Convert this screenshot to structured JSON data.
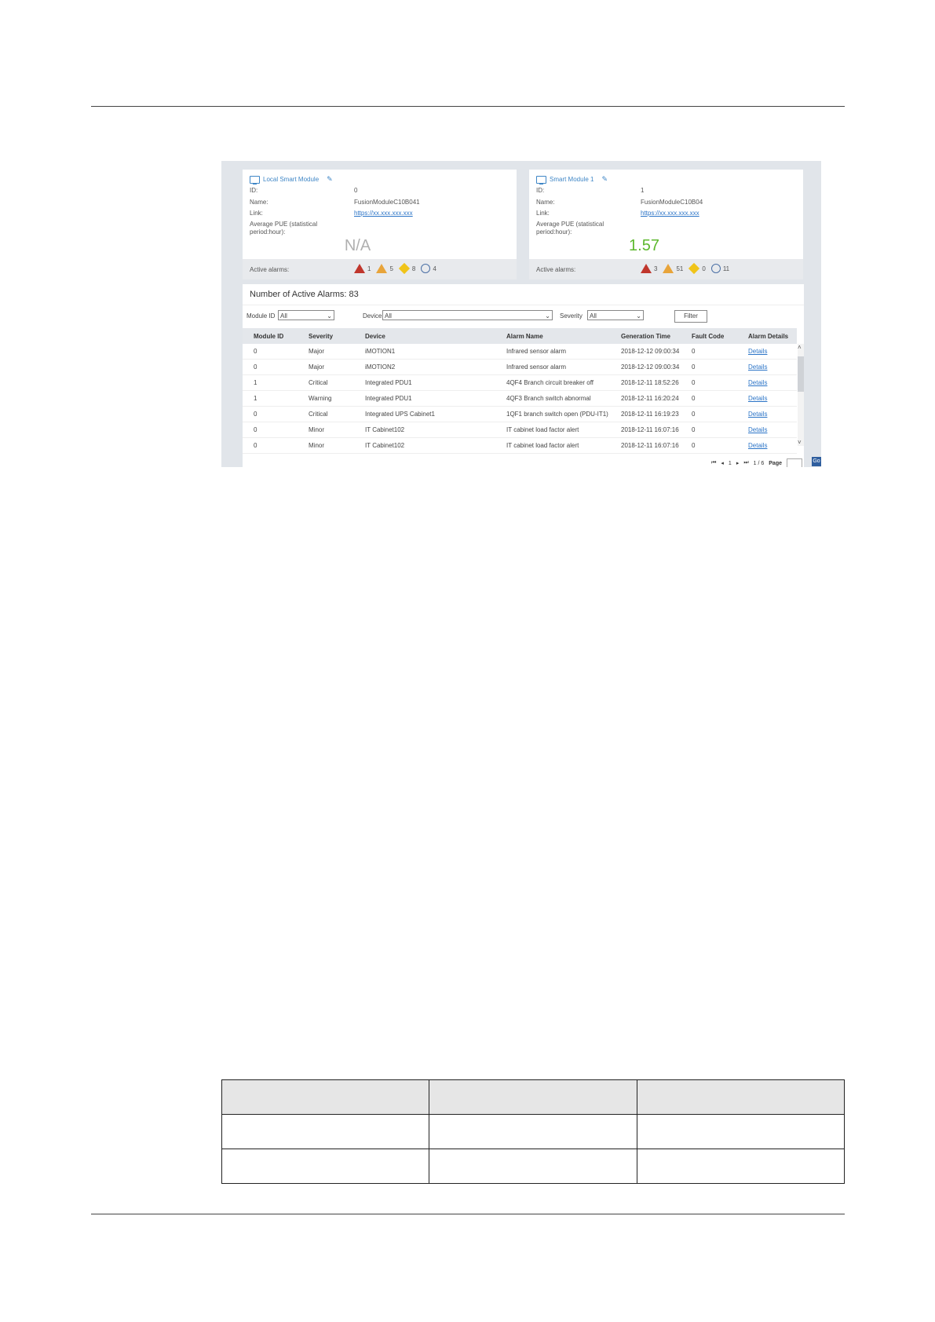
{
  "figure": {
    "modules": [
      {
        "title": "Local Smart Module",
        "fields": [
          {
            "label": "ID:",
            "value": "0"
          },
          {
            "label": "Name:",
            "value": "FusionModuleC10B041"
          },
          {
            "label": "Link:",
            "value": "https://xx.xxx.xxx.xxx"
          }
        ],
        "pue_label_1": "Average PUE (statistical",
        "pue_label_2": "period:hour):",
        "pue_value": "N/A",
        "alarms_label": "Active alarms:",
        "alarm_counts": {
          "critical": "1",
          "major": "5",
          "minor": "8",
          "warning": "4"
        }
      },
      {
        "title": "Smart Module 1",
        "fields": [
          {
            "label": "ID:",
            "value": "1"
          },
          {
            "label": "Name:",
            "value": "FusionModuleC10B04"
          },
          {
            "label": "Link:",
            "value": "https://xx.xxx.xxx.xxx"
          }
        ],
        "pue_label_1": "Average PUE (statistical",
        "pue_label_2": "period:hour):",
        "pue_value": "1.57",
        "alarms_label": "Active alarms:",
        "alarm_counts": {
          "critical": "3",
          "major": "51",
          "minor": "0",
          "warning": "11"
        }
      }
    ],
    "alarms_heading": "Number of Active Alarms: 83",
    "filters": {
      "module_id_label": "Module ID",
      "module_id_value": "All",
      "device_label": "Device",
      "device_value": "All",
      "severity_label": "Severity",
      "severity_value": "All",
      "filter_button": "Filter"
    },
    "table": {
      "headers": [
        "Module ID",
        "Severity",
        "Device",
        "Alarm Name",
        "Generation Time",
        "Fault Code",
        "Alarm Details"
      ],
      "rows": [
        [
          "0",
          "Major",
          "iMOTION1",
          "Infrared sensor alarm",
          "2018-12-12 09:00:34",
          "0",
          "Details"
        ],
        [
          "0",
          "Major",
          "iMOTION2",
          "Infrared sensor alarm",
          "2018-12-12 09:00:34",
          "0",
          "Details"
        ],
        [
          "1",
          "Critical",
          "Integrated PDU1",
          "4QF4 Branch circuit breaker off",
          "2018-12-11 18:52:26",
          "0",
          "Details"
        ],
        [
          "1",
          "Warning",
          "Integrated PDU1",
          "4QF3 Branch switch abnormal",
          "2018-12-11 16:20:24",
          "0",
          "Details"
        ],
        [
          "0",
          "Critical",
          "Integrated UPS Cabinet1",
          "1QF1 branch switch open (PDU-IT1)",
          "2018-12-11 16:19:23",
          "0",
          "Details"
        ],
        [
          "0",
          "Minor",
          "IT Cabinet102",
          "IT cabinet load factor alert",
          "2018-12-11 16:07:16",
          "0",
          "Details"
        ],
        [
          "0",
          "Minor",
          "IT Cabinet102",
          "IT cabinet load factor alert",
          "2018-12-11 16:07:16",
          "0",
          "Details"
        ]
      ]
    },
    "pager": {
      "page": "1",
      "total": "1 / 6",
      "page_label": "Page",
      "go": "Go"
    },
    "colors": {
      "na": "#b0b0b0",
      "pue_good": "#5cb82d",
      "link": "#2b74c7"
    }
  }
}
